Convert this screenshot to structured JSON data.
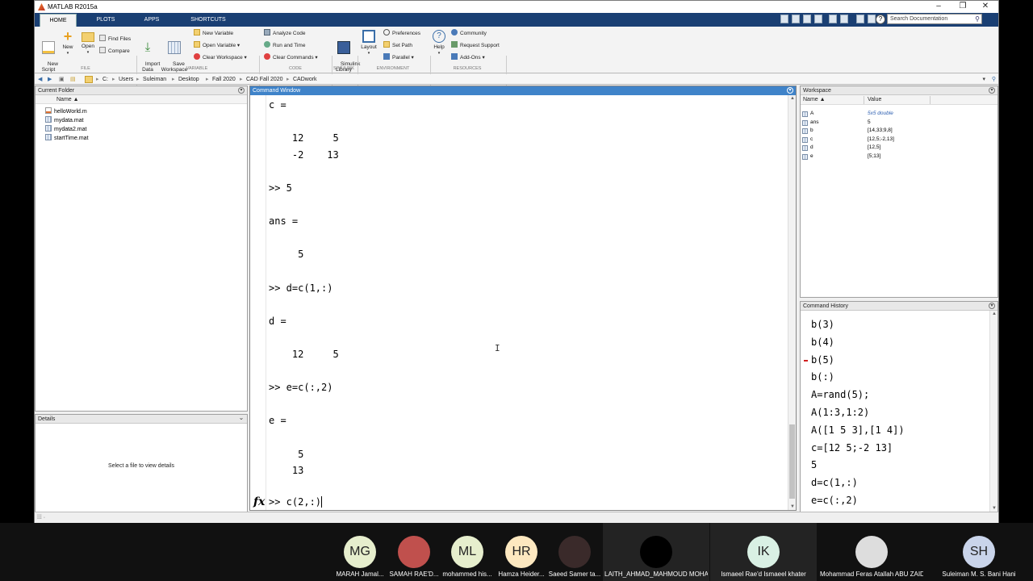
{
  "window": {
    "title": "MATLAB R2015a",
    "minimize": "–",
    "restore": "❐",
    "close": "✕"
  },
  "tabs": [
    "HOME",
    "PLOTS",
    "APPS",
    "SHORTCUTS"
  ],
  "search": {
    "placeholder": "Search Documentation"
  },
  "ribbon": {
    "file": {
      "new_script": "New\nScript",
      "new": "New",
      "open": "Open",
      "find_files": "Find Files",
      "compare": "Compare",
      "group": "FILE"
    },
    "variable": {
      "import_data": "Import\nData",
      "save_workspace": "Save\nWorkspace",
      "new_variable": "New Variable",
      "open_variable": "Open Variable",
      "clear_workspace": "Clear Workspace",
      "group": "VARIABLE"
    },
    "code": {
      "analyze_code": "Analyze Code",
      "run_and_time": "Run and Time",
      "clear_commands": "Clear Commands",
      "group": "CODE"
    },
    "simulink": {
      "library": "Simulink\nLibrary",
      "group": "SIMULINK"
    },
    "environment": {
      "layout": "Layout",
      "preferences": "Preferences",
      "set_path": "Set Path",
      "parallel": "Parallel",
      "group": "ENVIRONMENT"
    },
    "resources": {
      "help": "Help",
      "community": "Community",
      "request_support": "Request Support",
      "add_ons": "Add-Ons",
      "group": "RESOURCES"
    }
  },
  "address": {
    "path": [
      "C:",
      "Users",
      "Suleiman",
      "Desktop",
      "Fall 2020",
      "CAD Fall 2020",
      "CADwork"
    ]
  },
  "current_folder": {
    "title": "Current Folder",
    "column": "Name ▲",
    "files": [
      "helloWorld.m",
      "mydata.mat",
      "mydata2.mat",
      "startTime.mat"
    ]
  },
  "details": {
    "title": "Details",
    "message": "Select a file to view details"
  },
  "command_window": {
    "title": "Command Window",
    "lines": [
      "c =",
      "",
      "    12     5",
      "    -2    13",
      "",
      ">> 5",
      "",
      "ans =",
      "",
      "     5",
      "",
      ">> d=c(1,:)",
      "",
      "d =",
      "",
      "    12     5",
      "",
      ">> e=c(:,2)",
      "",
      "e =",
      "",
      "     5",
      "    13"
    ],
    "prompt": ">> c(2,:)",
    "fx": "fx"
  },
  "workspace": {
    "title": "Workspace",
    "col_name": "Name ▲",
    "col_value": "Value",
    "rows": [
      {
        "name": "A",
        "value": "5x5 double"
      },
      {
        "name": "ans",
        "value": "5"
      },
      {
        "name": "b",
        "value": "[14,33;9,8]"
      },
      {
        "name": "c",
        "value": "[12,5;-2,13]"
      },
      {
        "name": "d",
        "value": "[12,5]"
      },
      {
        "name": "e",
        "value": "[5;13]"
      }
    ]
  },
  "command_history": {
    "title": "Command History",
    "items": [
      "b(3)",
      "b(4)",
      "b(5)",
      "b(:)",
      "A=rand(5);",
      "A(1:3,1:2)",
      "A([1 5 3],[1 4])",
      "c=[12 5;-2 13]",
      "5",
      "d=c(1,:)",
      "e=c(:,2)"
    ],
    "error_index": 2
  },
  "status": {
    "text": "⁞⁞⁞ ·"
  },
  "participants": [
    {
      "initials": "MG",
      "name": "MARAH Jamal...",
      "color": "#e6eecd"
    },
    {
      "initials": "",
      "name": "SAMAH RAE'D...",
      "color": "#c0504d",
      "photo": true
    },
    {
      "initials": "ML",
      "name": "mohammed his...",
      "color": "#e6eecd"
    },
    {
      "initials": "HR",
      "name": "Hamza Heider...",
      "color": "#fde8c0"
    },
    {
      "initials": "",
      "name": "Saeed Samer ta...",
      "color": "#3a2a2a",
      "photo": true
    },
    {
      "initials": "",
      "name": "LAITH_AHMAD_MAHMOUD MOHA...",
      "color": "#000000"
    },
    {
      "initials": "IK",
      "name": "Ismaeel Rae'd Ismaeel khater",
      "color": "#d9f0e4"
    },
    {
      "initials": "",
      "name": "Mohammad Feras Atallah ABU ZAID",
      "color": "#ddd",
      "photo": true
    },
    {
      "initials": "SH",
      "name": "Suleiman M. S. Bani Hani",
      "color": "#c9d4ea"
    }
  ]
}
